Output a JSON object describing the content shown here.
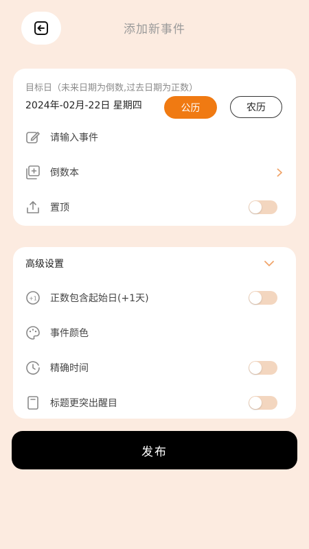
{
  "header": {
    "title": "添加新事件",
    "back_icon": "back-arrow-icon"
  },
  "date_card": {
    "hint": "目标日（未来日期为倒数,过去日期为正数）",
    "date": "2024年-02月-22日 星期四",
    "solar_label": "公历",
    "lunar_label": "农历",
    "selected_calendar": "公历",
    "accent_color": "#f07a12",
    "event_placeholder": "请输入事件",
    "book_label": "倒数本",
    "pin_label": "置顶",
    "pin_on": false
  },
  "advanced": {
    "title": "高级设置",
    "items": [
      {
        "label": "正数包含起始日(+1天)",
        "icon": "plus-one-icon",
        "toggle": false
      },
      {
        "label": "事件颜色",
        "icon": "palette-icon"
      },
      {
        "label": "精确时间",
        "icon": "clock-icon",
        "toggle": false
      },
      {
        "label": "标题更突出醒目",
        "icon": "title-emphasis-icon",
        "toggle": false
      }
    ]
  },
  "publish_label": "发布"
}
